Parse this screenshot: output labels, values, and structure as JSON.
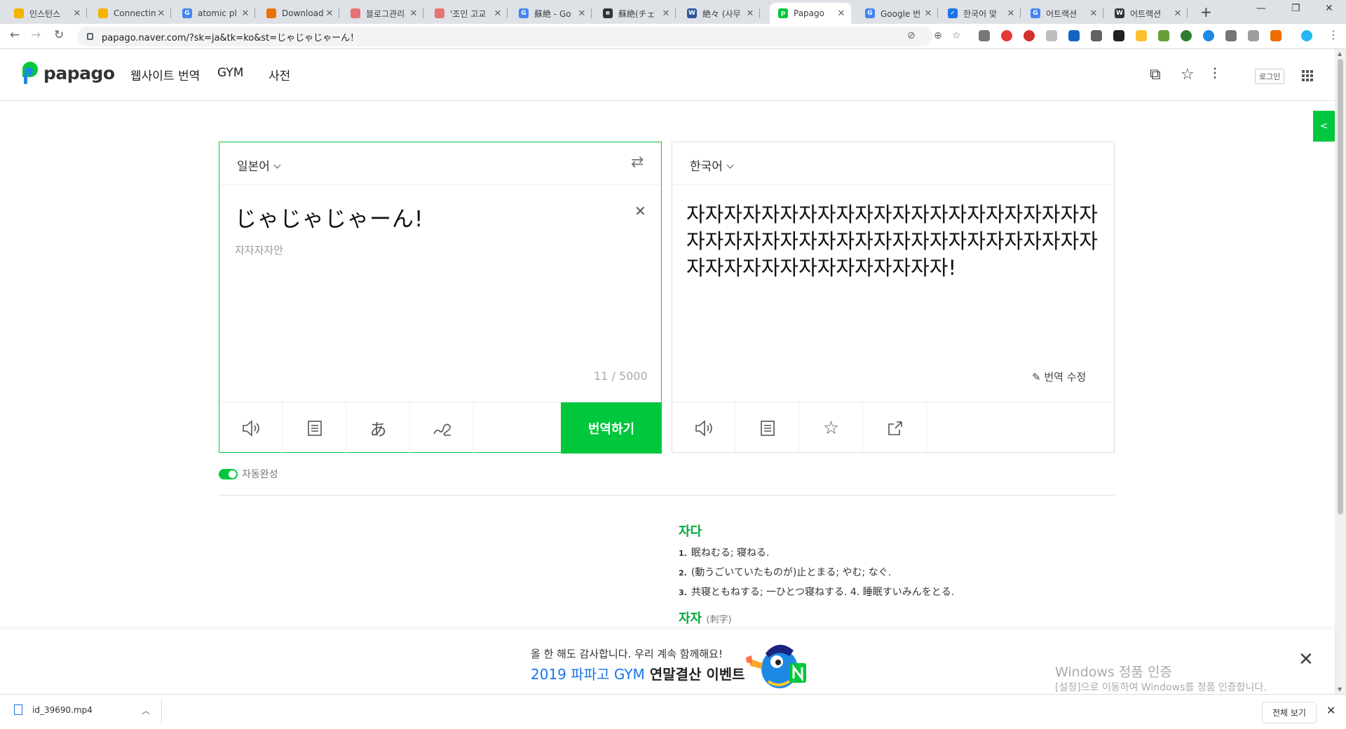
{
  "browser": {
    "tabs": [
      {
        "title": "인스턴스",
        "fav_color": "#f4b400",
        "fav_glyph": ""
      },
      {
        "title": "Connecting",
        "fav_color": "#f4b400",
        "fav_glyph": ""
      },
      {
        "title": "atomic pl",
        "fav_color": "#4285f4",
        "fav_glyph": "G"
      },
      {
        "title": "Download",
        "fav_color": "#e8710a",
        "fav_glyph": ""
      },
      {
        "title": "블로그관리",
        "fav_color": "#e57373",
        "fav_glyph": ""
      },
      {
        "title": "'조인 고교",
        "fav_color": "#e57373",
        "fav_glyph": ""
      },
      {
        "title": "蘇絶 - Go",
        "fav_color": "#4285f4",
        "fav_glyph": "G"
      },
      {
        "title": "蘇絶(チェ",
        "fav_color": "#333333",
        "fav_glyph": "e"
      },
      {
        "title": "絶々 (사무",
        "fav_color": "#2b579a",
        "fav_glyph": "W"
      },
      {
        "title": "Papago",
        "fav_color": "#00c73c",
        "fav_glyph": "p"
      },
      {
        "title": "Google 번",
        "fav_color": "#4285f4",
        "fav_glyph": "G"
      },
      {
        "title": "한국어 맞",
        "fav_color": "#1a73e8",
        "fav_glyph": "✓"
      },
      {
        "title": "어트랙션",
        "fav_color": "#4285f4",
        "fav_glyph": "G"
      },
      {
        "title": "어트랙션",
        "fav_color": "#333333",
        "fav_glyph": "W"
      }
    ],
    "active_tab_index": 9,
    "url": "papago.naver.com/?sk=ja&tk=ko&st=じゃじゃじゃーん！"
  },
  "header": {
    "logo_text": "papago",
    "nav": [
      "웹사이트 번역",
      "GYM",
      "사전"
    ],
    "login_label": "로그인"
  },
  "source": {
    "language": "일본어",
    "text": "じゃじゃじゃーん!",
    "pronunciation": "자자자자안",
    "counter": "11 / 5000",
    "translate_label": "번역하기"
  },
  "target": {
    "language": "한국어",
    "text": "자자자자자자자자자자자자자자자자자자자자자자자자자자자자자자자자자자자자자자자자자자자자자자자자자자자자자자자자자자!",
    "edit_label": "번역 수정"
  },
  "autocomplete_label": "자동완성",
  "dictionary": {
    "term": "자다",
    "lines": [
      {
        "n": "1.",
        "text": "眠ねむる; 寝ねる."
      },
      {
        "n": "2.",
        "text": "(動うごいていたものが)止とまる; やむ; なぐ."
      },
      {
        "n": "3.",
        "text": "共寝ともねする; 一ひとつ寝ねする.  4. 睡眠すいみんをとる."
      }
    ],
    "term2": "자자",
    "term2_sub": "(刺字)"
  },
  "banner": {
    "line1": "올 한 해도 감사합니다. 우리 계속 함께해요!",
    "line2_blue": "2019 파파고 GYM",
    "line2_bold": "연말결산 이벤트",
    "watermark_title": "Windows 정품 인증",
    "watermark_sub": "[설정]으로 이동하여 Windows를 정품 인증합니다."
  },
  "downloads": {
    "filename": "id_39690.mp4",
    "show_all": "전체 보기"
  }
}
